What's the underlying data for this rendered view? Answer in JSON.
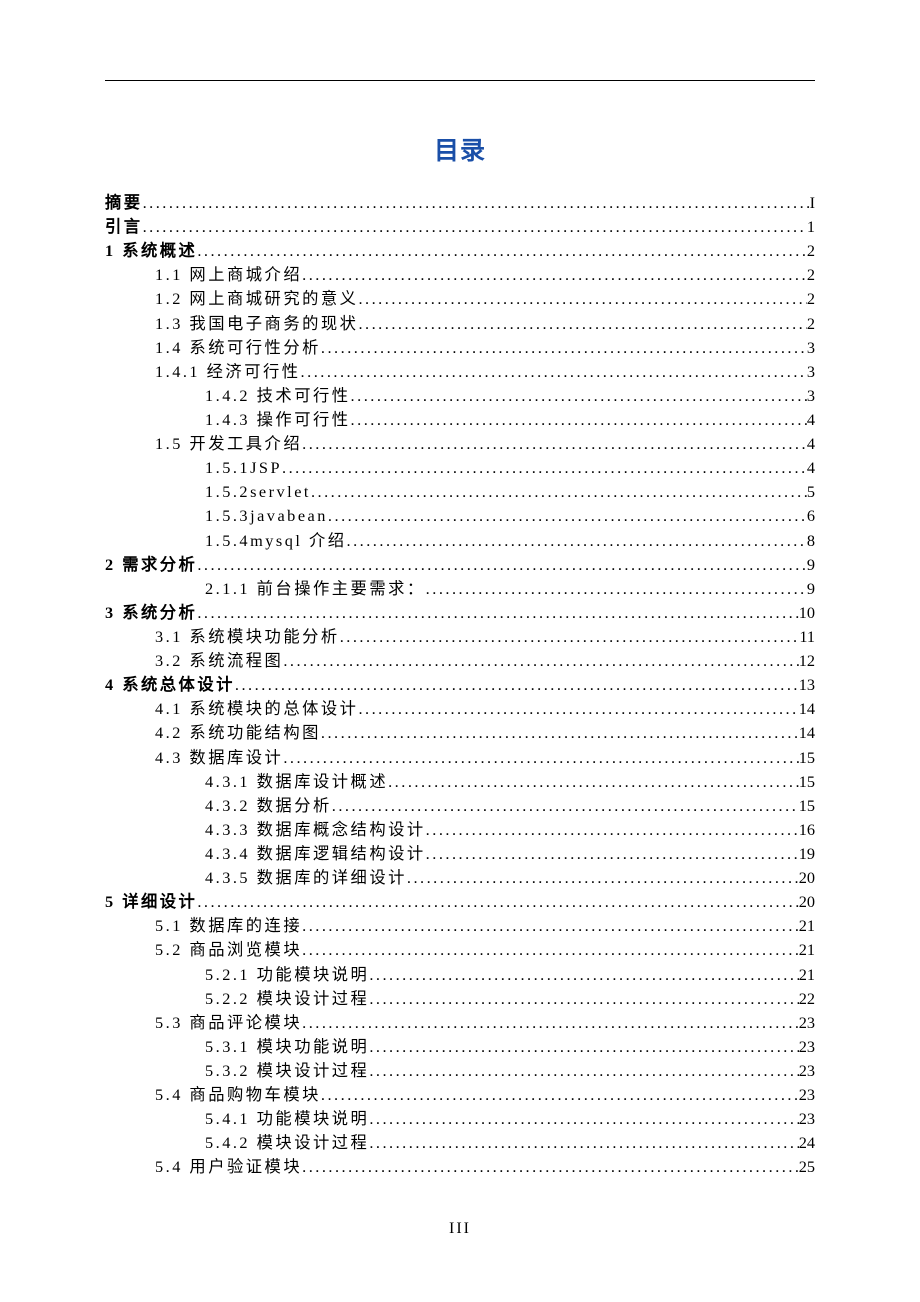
{
  "title": "目录",
  "page_number": "III",
  "entries": [
    {
      "level": 0,
      "label": "摘要",
      "page": "I",
      "top": true
    },
    {
      "level": 0,
      "label": "引言",
      "page": "1",
      "top": true
    },
    {
      "level": 0,
      "label": "1 系统概述",
      "page": "2",
      "top": true
    },
    {
      "level": 1,
      "label": "1.1 网上商城介绍",
      "page": "2"
    },
    {
      "level": 1,
      "label": "1.2 网上商城研究的意义",
      "page": "2"
    },
    {
      "level": 1,
      "label": "1.3 我国电子商务的现状",
      "page": "2"
    },
    {
      "level": 1,
      "label": "1.4 系统可行性分析",
      "page": "3"
    },
    {
      "level": 1,
      "label": "1.4.1 经济可行性",
      "page": "3"
    },
    {
      "level": 2,
      "label": "1.4.2 技术可行性",
      "page": "3"
    },
    {
      "level": 2,
      "label": "1.4.3 操作可行性",
      "page": "4"
    },
    {
      "level": 1,
      "label": "1.5 开发工具介绍",
      "page": "4"
    },
    {
      "level": 2,
      "label": "1.5.1JSP",
      "page": "4"
    },
    {
      "level": 2,
      "label": "1.5.2servlet",
      "page": "5"
    },
    {
      "level": 2,
      "label": "1.5.3javabean",
      "page": "6"
    },
    {
      "level": 2,
      "label": "1.5.4mysql 介绍",
      "page": "8"
    },
    {
      "level": 0,
      "label": "2 需求分析",
      "page": "9",
      "top": true
    },
    {
      "level": 2,
      "label": "2.1.1 前台操作主要需求：",
      "page": "9"
    },
    {
      "level": 0,
      "label": "3 系统分析",
      "page": "10",
      "top": true
    },
    {
      "level": 1,
      "label": "3.1 系统模块功能分析",
      "page": "11"
    },
    {
      "level": 1,
      "label": "3.2 系统流程图",
      "page": "12"
    },
    {
      "level": 0,
      "label": "4 系统总体设计",
      "page": "13",
      "top": true
    },
    {
      "level": 1,
      "label": "4.1 系统模块的总体设计",
      "page": "14"
    },
    {
      "level": 1,
      "label": "4.2 系统功能结构图",
      "page": "14"
    },
    {
      "level": 1,
      "label": "4.3 数据库设计",
      "page": "15"
    },
    {
      "level": 2,
      "label": "4.3.1 数据库设计概述",
      "page": "15"
    },
    {
      "level": 2,
      "label": "4.3.2 数据分析",
      "page": "15"
    },
    {
      "level": 2,
      "label": "4.3.3 数据库概念结构设计",
      "page": "16"
    },
    {
      "level": 2,
      "label": "4.3.4 数据库逻辑结构设计",
      "page": "19"
    },
    {
      "level": 2,
      "label": "4.3.5 数据库的详细设计",
      "page": "20"
    },
    {
      "level": 0,
      "label": "5 详细设计",
      "page": "20",
      "top": true
    },
    {
      "level": 1,
      "label": "5.1 数据库的连接",
      "page": "21"
    },
    {
      "level": 1,
      "label": "5.2 商品浏览模块",
      "page": "21"
    },
    {
      "level": 2,
      "label": "5.2.1  功能模块说明",
      "page": "21"
    },
    {
      "level": 2,
      "label": "5.2.2 模块设计过程",
      "page": "22"
    },
    {
      "level": 1,
      "label": "5.3 商品评论模块",
      "page": "23"
    },
    {
      "level": 2,
      "label": "5.3.1 模块功能说明",
      "page": "23"
    },
    {
      "level": 2,
      "label": "5.3.2 模块设计过程",
      "page": "23"
    },
    {
      "level": 1,
      "label": "5.4 商品购物车模块",
      "page": "23"
    },
    {
      "level": 2,
      "label": "5.4.1 功能模块说明",
      "page": "23"
    },
    {
      "level": 2,
      "label": "5.4.2 模块设计过程",
      "page": "24"
    },
    {
      "level": 1,
      "label": "5.4 用户验证模块",
      "page": "25"
    }
  ]
}
